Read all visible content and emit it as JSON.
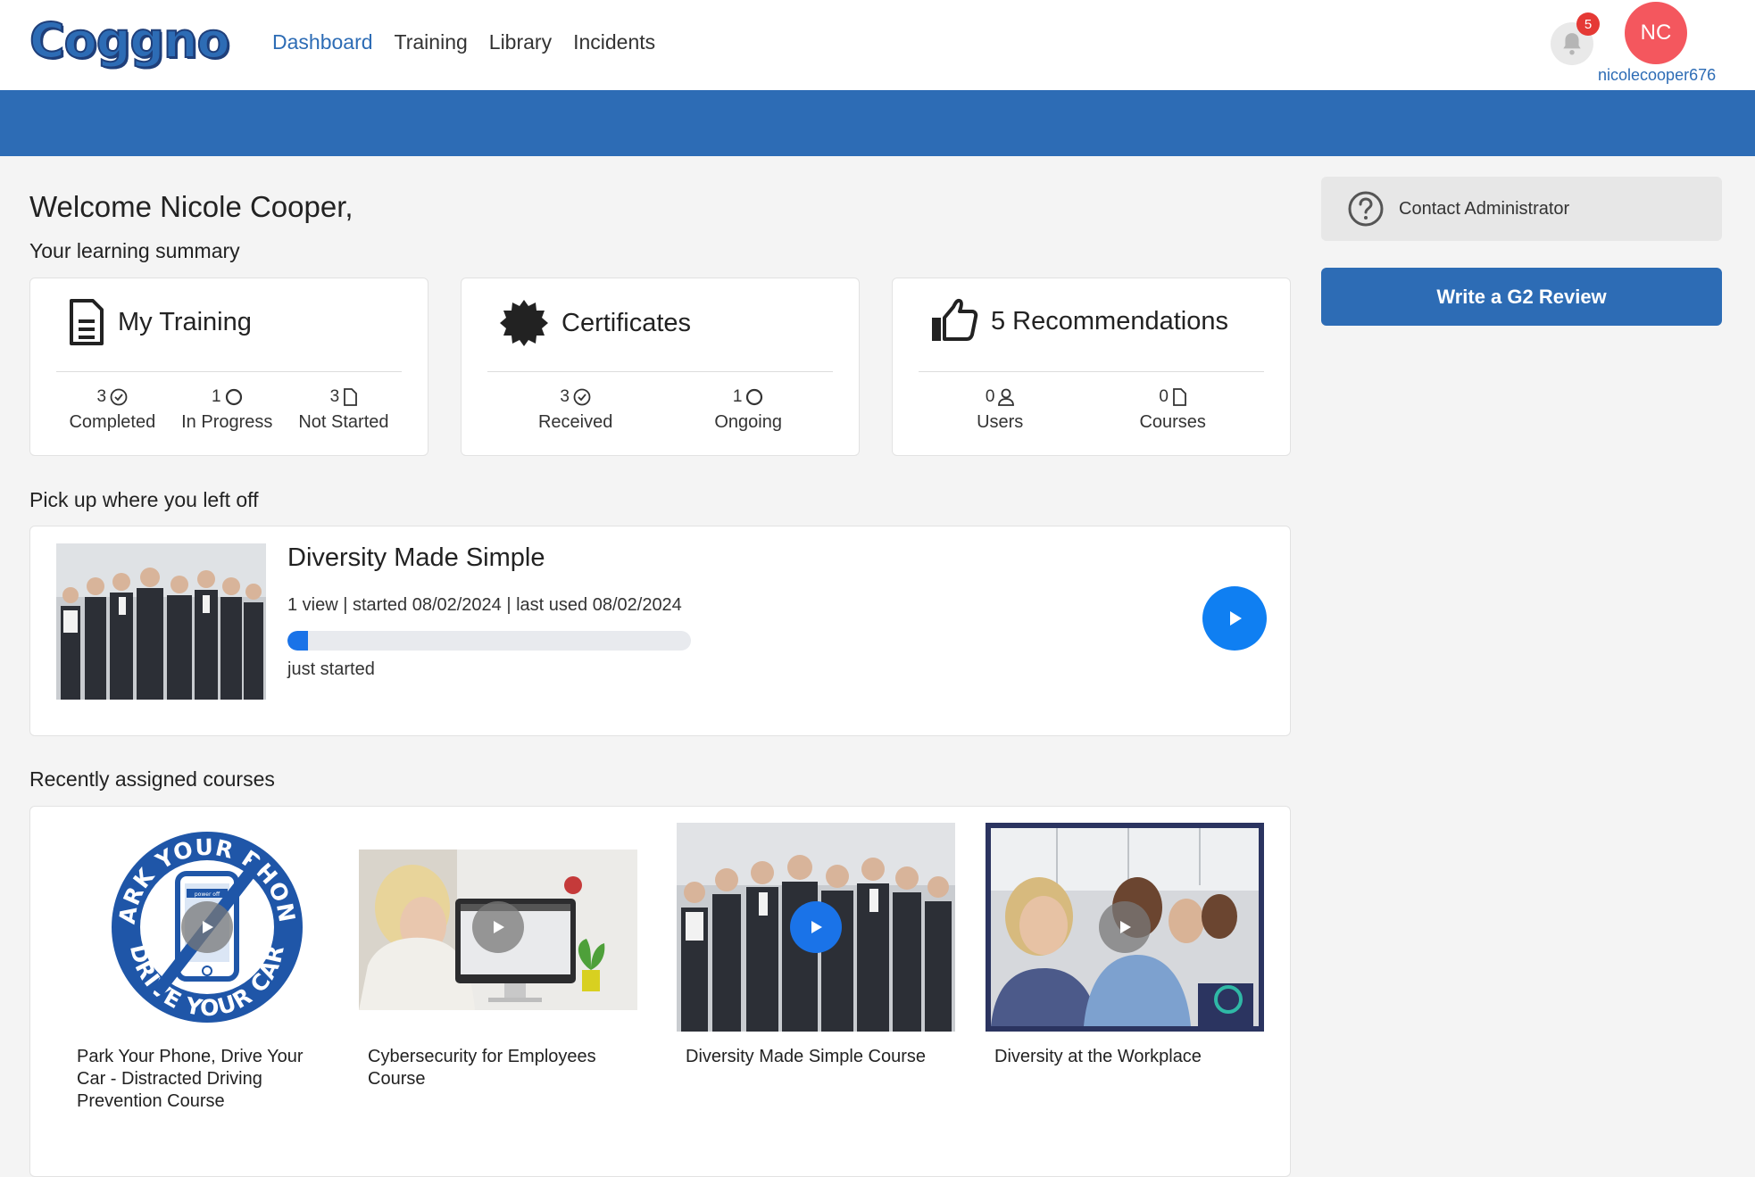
{
  "header": {
    "logo": "Coggno",
    "nav": [
      {
        "label": "Dashboard",
        "active": true
      },
      {
        "label": "Training"
      },
      {
        "label": "Library"
      },
      {
        "label": "Incidents"
      }
    ],
    "notifications_count": "5",
    "avatar_initials": "NC",
    "username": "nicolecooper676"
  },
  "welcome": {
    "greeting": "Welcome Nicole Cooper,",
    "summary_label": "Your learning summary"
  },
  "summary": {
    "training": {
      "title": "My Training",
      "stats": [
        {
          "count": "3",
          "label": "Completed",
          "icon": "check-circle-icon"
        },
        {
          "count": "1",
          "label": "In Progress",
          "icon": "circle-icon"
        },
        {
          "count": "3",
          "label": "Not Started",
          "icon": "file-icon"
        }
      ]
    },
    "certificates": {
      "title": "Certificates",
      "stats": [
        {
          "count": "3",
          "label": "Received",
          "icon": "check-circle-icon"
        },
        {
          "count": "1",
          "label": "Ongoing",
          "icon": "circle-icon"
        }
      ]
    },
    "recommendations": {
      "title": "5 Recommendations",
      "stats": [
        {
          "count": "0",
          "label": "Users",
          "icon": "user-icon"
        },
        {
          "count": "0",
          "label": "Courses",
          "icon": "file-icon"
        }
      ]
    }
  },
  "continue": {
    "section_label": "Pick up where you left off",
    "title": "Diversity Made Simple",
    "meta": "1 view | started 08/02/2024 | last used 08/02/2024",
    "progress_fraction": 0.05,
    "status": "just started"
  },
  "courses": {
    "section_label": "Recently assigned courses",
    "items": [
      {
        "title": "Park Your Phone, Drive Your Car - Distracted Driving Prevention Course"
      },
      {
        "title": "Cybersecurity for Employees Course"
      },
      {
        "title": "Diversity Made Simple Course"
      },
      {
        "title": "Diversity at the Workplace"
      }
    ],
    "park_logo_text_top": "PARK YOUR PHONE",
    "park_logo_text_bottom": "DRIVE YOUR CAR",
    "park_logo_screen_text": "power off"
  },
  "sidebar": {
    "contact_label": "Contact Administrator",
    "g2_label": "Write a G2 Review"
  },
  "colors": {
    "brand_blue": "#2d6cb5",
    "play_blue": "#0f7ff2",
    "avatar": "#f4575e",
    "badge": "#e53935"
  }
}
